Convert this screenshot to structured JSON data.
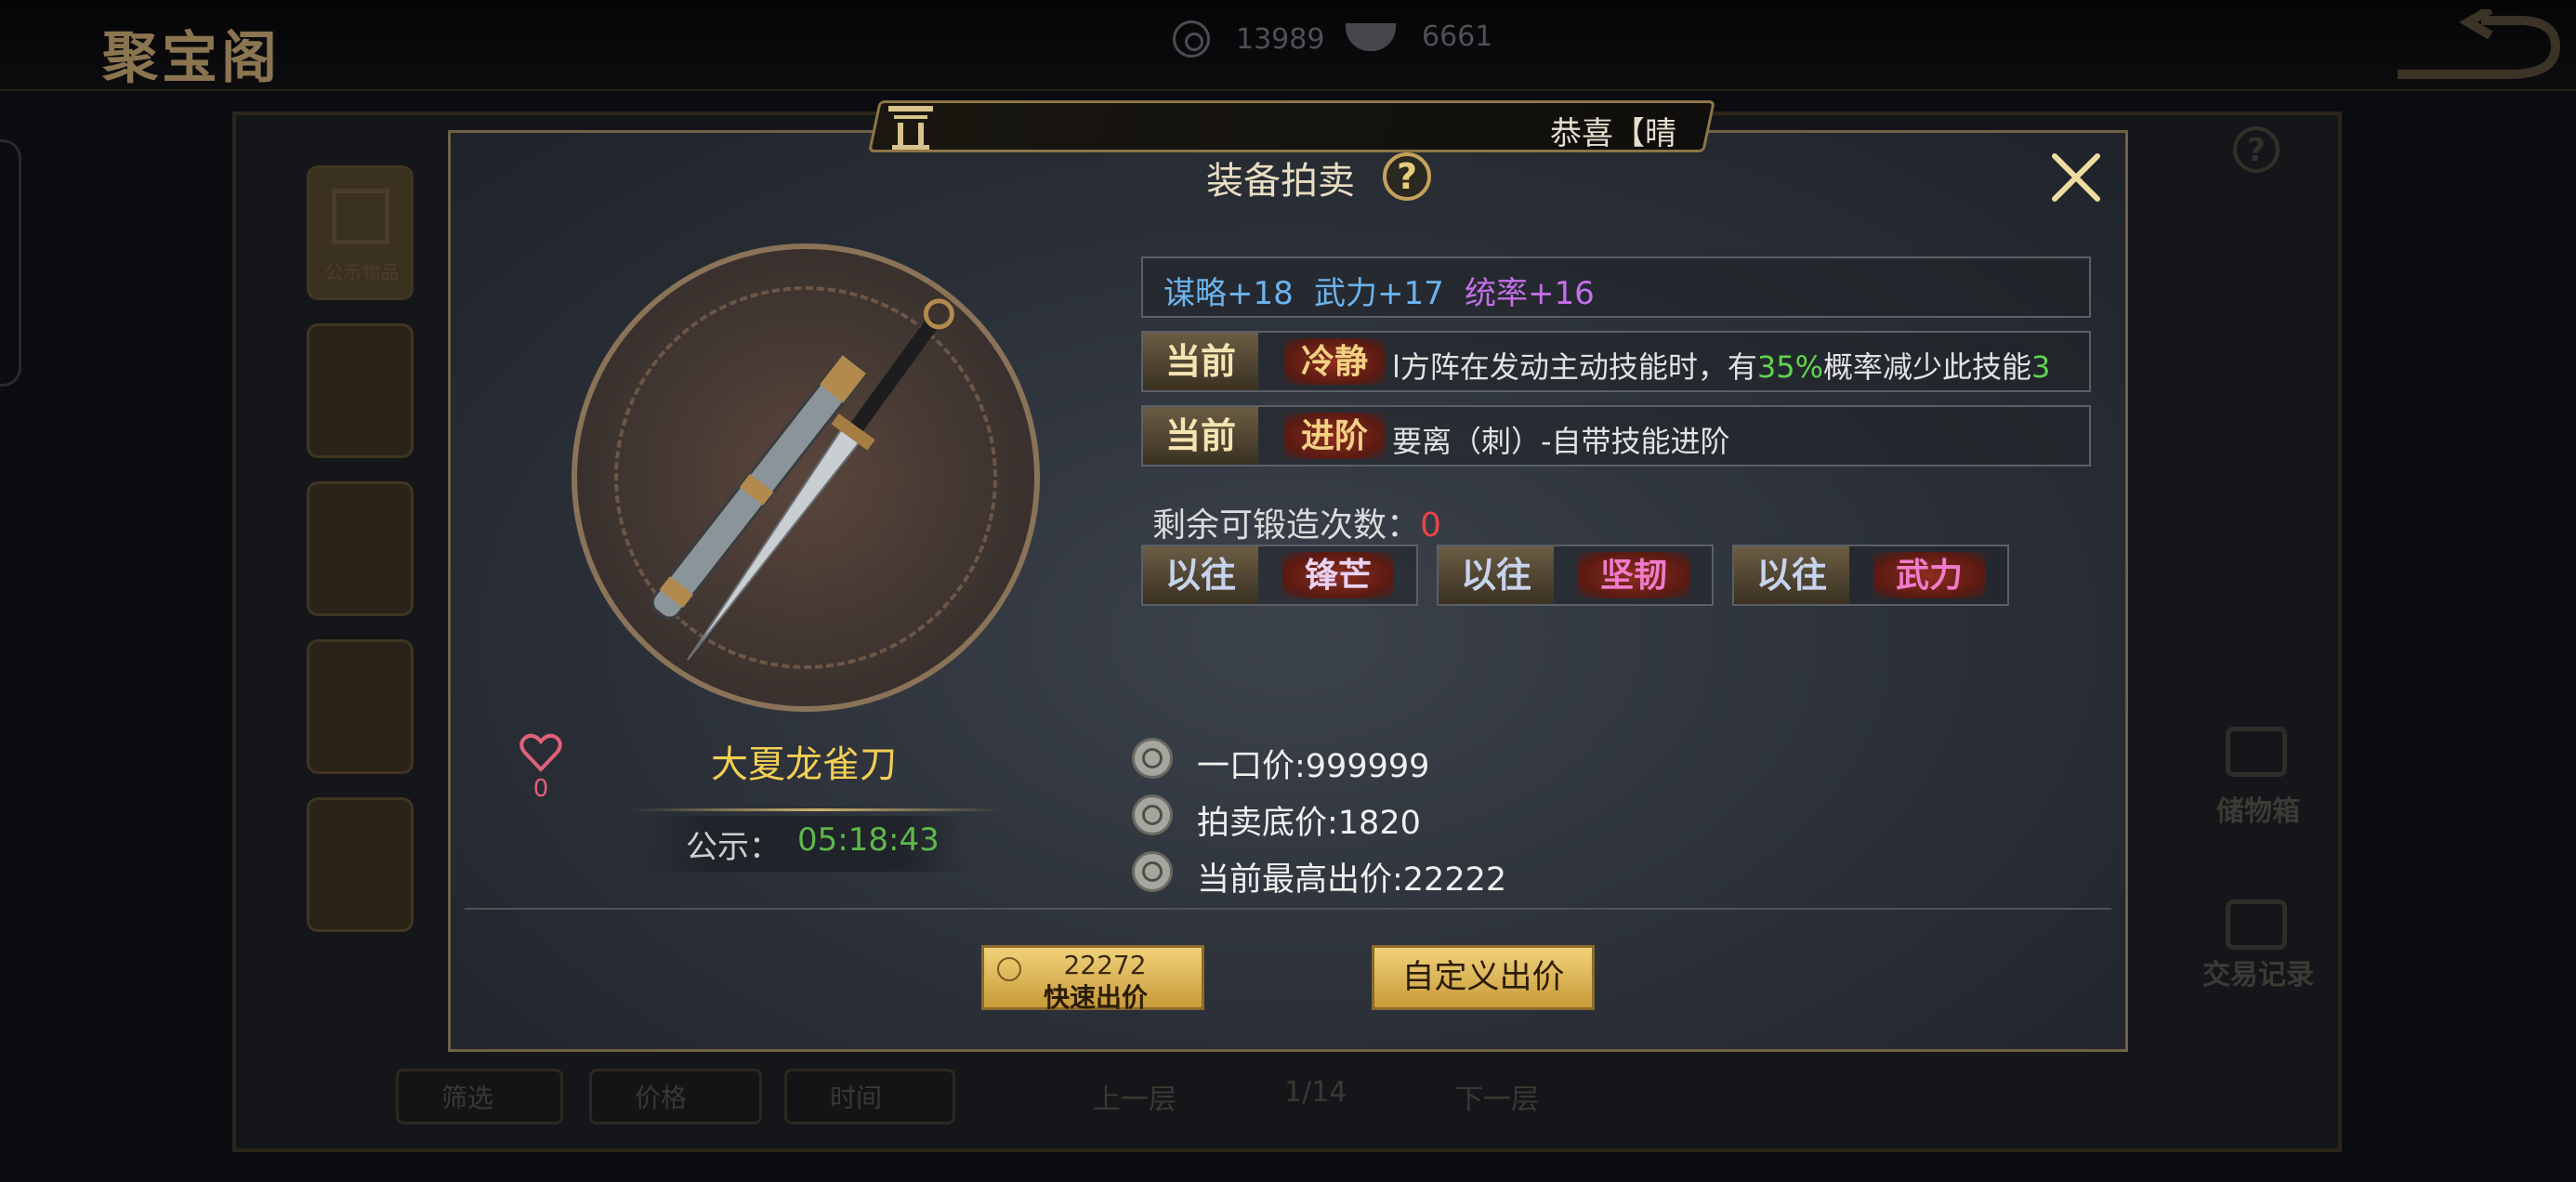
{
  "top_bar": {
    "title": "聚宝阁",
    "currency": [
      {
        "icon": "copper-coin-icon",
        "value": "13989"
      },
      {
        "icon": "silver-ingot-icon",
        "value": "6661"
      }
    ]
  },
  "background": {
    "side_tab_label": "公示物品",
    "right_panel": {
      "storage_label": "储物箱",
      "history_label": "交易记录"
    },
    "bottom_bar": {
      "filter_label": "筛选",
      "price_label": "价格",
      "time_label": "时间",
      "prev_label": "上一层",
      "page_indicator": "1/14",
      "next_label": "下一层"
    }
  },
  "ticker": {
    "text": "恭喜【晴"
  },
  "dialog": {
    "title": "装备拍卖",
    "item": {
      "name": "大夏龙雀刀",
      "favorite_count": "0",
      "notice_label": "公示：",
      "notice_time": "05:18:43"
    },
    "stats": [
      {
        "label": "谋略+18",
        "color": "#6cb3ee"
      },
      {
        "label": "武力+17",
        "color": "#6cb3ee"
      },
      {
        "label": "统率+16",
        "color": "#c46ee8"
      }
    ],
    "current_skills": [
      {
        "badge": "当前",
        "skill": "冷静",
        "desc_before": "l方阵在发动主动技能时，有",
        "desc_highlight": "35%",
        "desc_after": "概率减少此技能",
        "desc_tail": "3"
      },
      {
        "badge": "当前",
        "skill": "进阶",
        "desc": "要离（刺）-自带技能进阶"
      }
    ],
    "forge": {
      "label": "剩余可锻造次数：",
      "count": "0"
    },
    "past_skills": [
      {
        "badge": "以往",
        "skill": "锋芒",
        "color": "#e9d3f4"
      },
      {
        "badge": "以往",
        "skill": "坚韧",
        "color": "#f07acb"
      },
      {
        "badge": "以往",
        "skill": "武力",
        "color": "#f07acb"
      }
    ],
    "prices": [
      {
        "label": "一口价:999999"
      },
      {
        "label": "拍卖底价:1820"
      },
      {
        "label": "当前最高出价:22222"
      }
    ],
    "buttons": {
      "quick_bid_price": "22272",
      "quick_bid_label": "快速出价",
      "custom_bid_label": "自定义出价"
    }
  }
}
